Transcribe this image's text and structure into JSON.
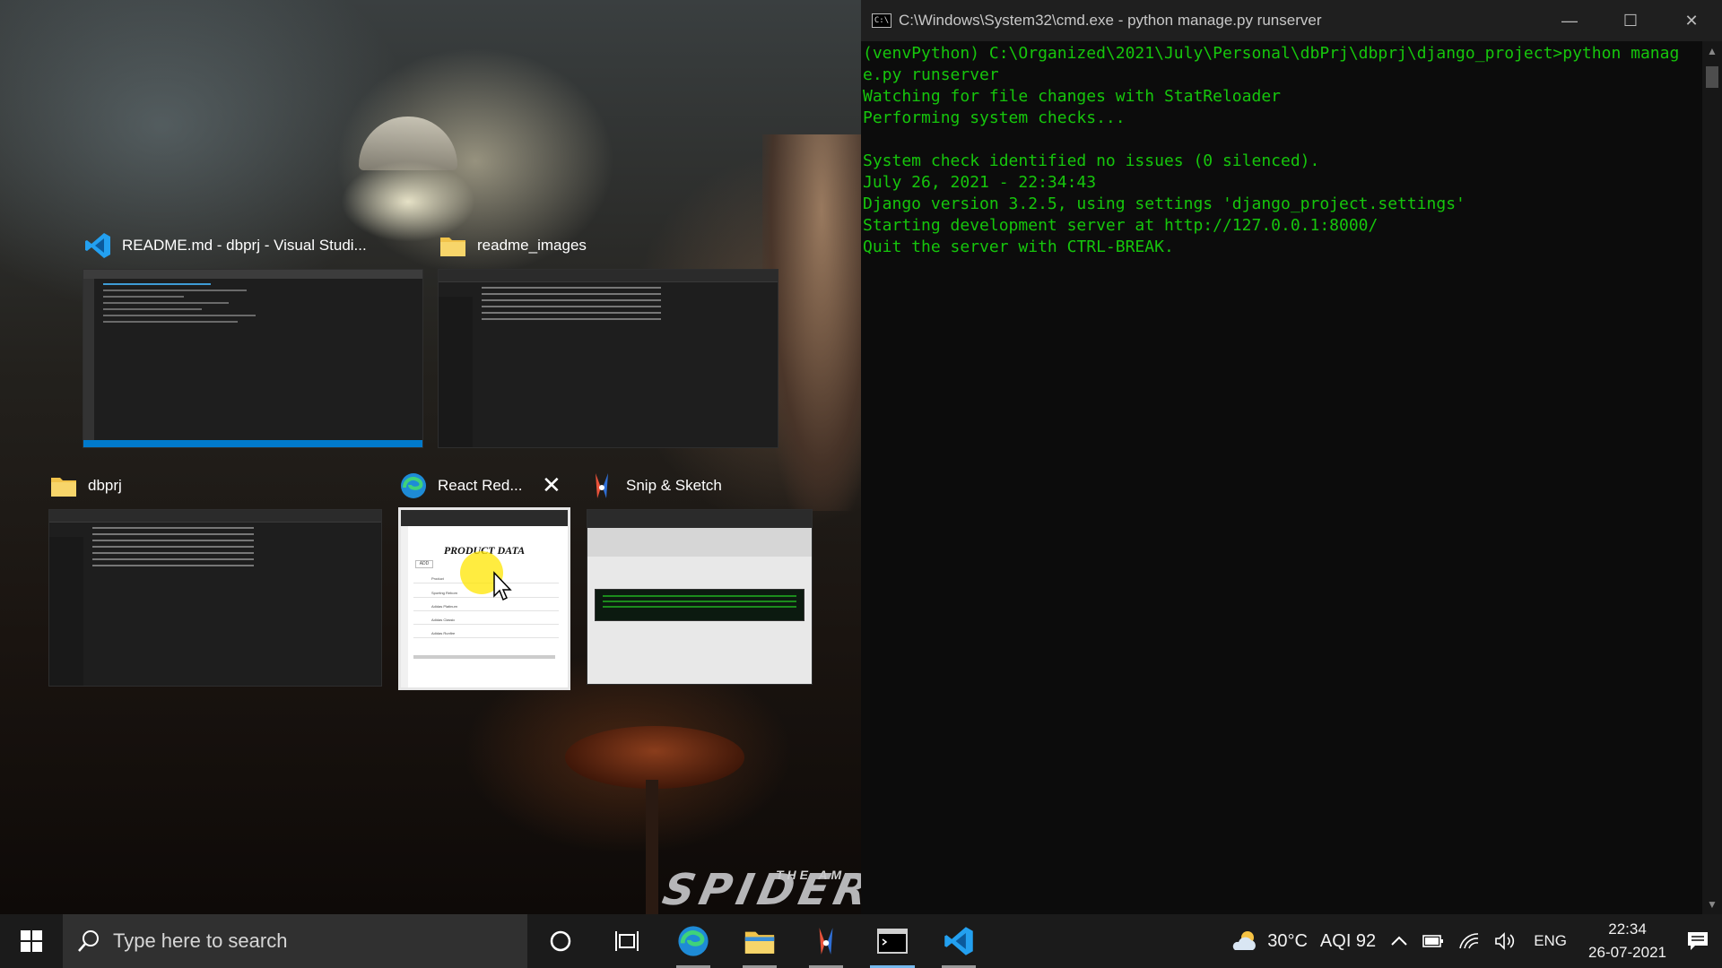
{
  "console": {
    "title": "C:\\Windows\\System32\\cmd.exe - python  manage.py runserver",
    "lines": [
      "(venvPython) C:\\Organized\\2021\\July\\Personal\\dbPrj\\dbprj\\django_project>python manag",
      "e.py runserver",
      "Watching for file changes with StatReloader",
      "Performing system checks...",
      "",
      "System check identified no issues (0 silenced).",
      "July 26, 2021 - 22:34:43",
      "Django version 3.2.5, using settings 'django_project.settings'",
      "Starting development server at http://127.0.0.1:8000/",
      "Quit the server with CTRL-BREAK."
    ]
  },
  "task_view": {
    "windows": [
      {
        "title": "README.md - dbprj - Visual Studi...",
        "icon": "vscode-icon"
      },
      {
        "title": "readme_images",
        "icon": "folder-icon"
      },
      {
        "title": "dbprj",
        "icon": "folder-icon"
      },
      {
        "title": "React Red...",
        "icon": "edge-icon"
      },
      {
        "title": "Snip & Sketch",
        "icon": "snip-sketch-icon"
      }
    ],
    "react_thumb": {
      "heading": "PRODUCT DATA",
      "button": "ADD",
      "rows": [
        "Product",
        "Sporting Reborn",
        "Adidas Platinum",
        "Adidas Classic",
        "Adidas Runfire"
      ]
    }
  },
  "wallpaper": {
    "title": "SPIDER",
    "subtitle": "THE AM"
  },
  "taskbar": {
    "search_placeholder": "Type here to search",
    "apps": [
      "cortana-icon",
      "task-view-icon",
      "edge-icon",
      "file-explorer-icon",
      "snip-sketch-icon",
      "cmd-icon",
      "vscode-icon"
    ],
    "weather": "30°C",
    "aqi": "AQI 92",
    "language": "ENG",
    "time": "22:34",
    "date": "26-07-2021"
  },
  "colors": {
    "console_text": "#16c60c",
    "accent": "#76b9ed",
    "vscode_blue": "#007acc"
  }
}
